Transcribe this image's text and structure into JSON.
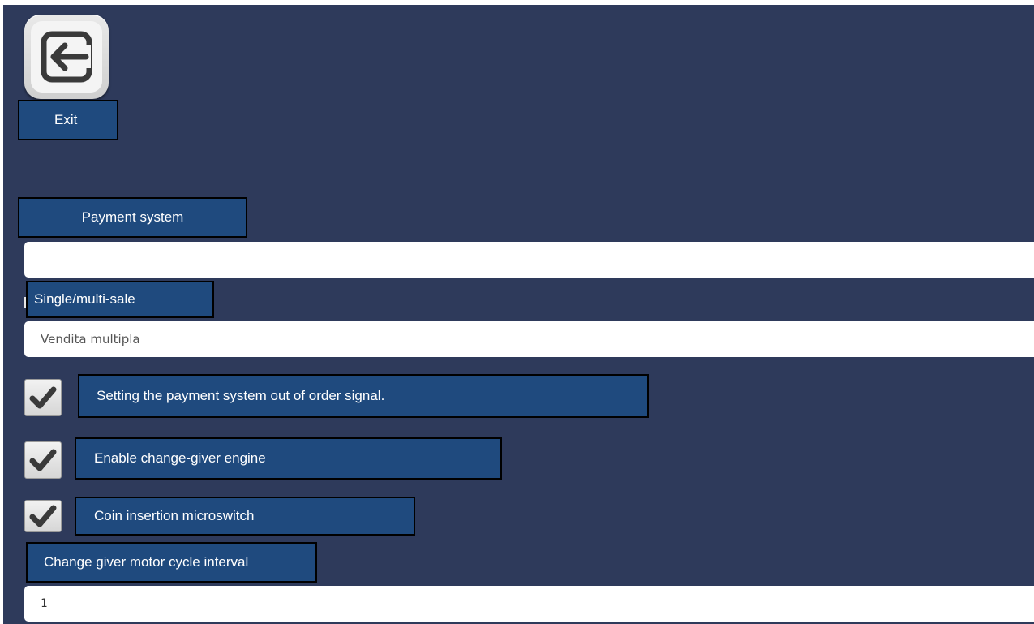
{
  "header": {
    "exit_icon": "exit-door-arrow-icon",
    "exit_label": "Exit"
  },
  "section": {
    "title": "Payment system",
    "top_field_value": ""
  },
  "single_multi_sale": {
    "label": "Single/multi-sale",
    "value": "Vendita multipla"
  },
  "options": [
    {
      "label": "Setting the payment system out of order signal.",
      "checked": true
    },
    {
      "label": "Enable change-giver engine",
      "checked": true
    },
    {
      "label": "Coin insertion microswitch",
      "checked": true
    }
  ],
  "motor_interval": {
    "label": "Change giver motor cycle interval",
    "value": "1"
  },
  "colors": {
    "background": "#2e3a5b",
    "label_fill": "#1f4a7e",
    "label_border": "#000000"
  }
}
